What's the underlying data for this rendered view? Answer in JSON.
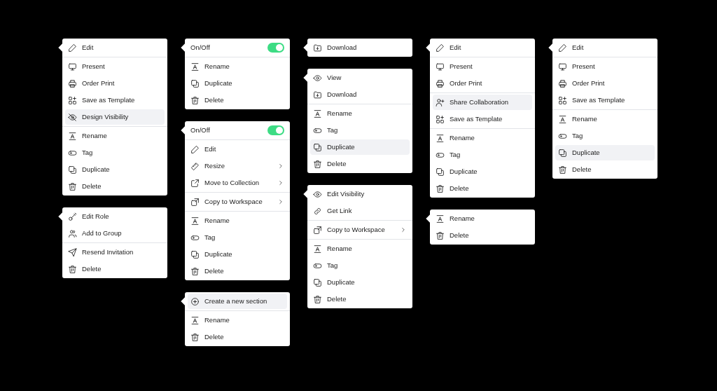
{
  "columns": [
    {
      "menus": [
        {
          "sections": [
            [
              {
                "kind": "edit",
                "label": "Edit",
                "selected": false,
                "submenu": false
              }
            ],
            [
              {
                "kind": "present",
                "label": "Present",
                "selected": false,
                "submenu": false
              },
              {
                "kind": "print",
                "label": "Order Print",
                "selected": false,
                "submenu": false
              },
              {
                "kind": "template",
                "label": "Save as Template",
                "selected": false,
                "submenu": false
              },
              {
                "kind": "hide",
                "label": "Design Visibility",
                "selected": true,
                "submenu": false
              }
            ],
            [
              {
                "kind": "rename",
                "label": "Rename",
                "selected": false,
                "submenu": false
              },
              {
                "kind": "tag",
                "label": "Tag",
                "selected": false,
                "submenu": false
              },
              {
                "kind": "duplicate",
                "label": "Duplicate",
                "selected": false,
                "submenu": false
              },
              {
                "kind": "delete",
                "label": "Delete",
                "selected": false,
                "submenu": false
              }
            ]
          ]
        },
        {
          "sections": [
            [
              {
                "kind": "key",
                "label": "Edit Role",
                "selected": false,
                "submenu": false
              },
              {
                "kind": "users",
                "label": "Add to Group",
                "selected": false,
                "submenu": false
              }
            ],
            [
              {
                "kind": "send",
                "label": "Resend Invitation",
                "selected": false,
                "submenu": false
              },
              {
                "kind": "delete",
                "label": "Delete",
                "selected": false,
                "submenu": false
              }
            ]
          ]
        }
      ]
    },
    {
      "menus": [
        {
          "sections": [
            [
              {
                "kind": "toggle",
                "label": "On/Off",
                "on": true,
                "selected": false,
                "submenu": false
              }
            ],
            [
              {
                "kind": "rename",
                "label": "Rename",
                "selected": false,
                "submenu": false
              },
              {
                "kind": "duplicate",
                "label": "Duplicate",
                "selected": false,
                "submenu": false
              },
              {
                "kind": "delete",
                "label": "Delete",
                "selected": false,
                "submenu": false
              }
            ]
          ]
        },
        {
          "sections": [
            [
              {
                "kind": "toggle",
                "label": "On/Off",
                "on": true,
                "selected": false,
                "submenu": false
              }
            ],
            [
              {
                "kind": "edit",
                "label": "Edit",
                "selected": false,
                "submenu": false
              },
              {
                "kind": "resize",
                "label": "Resize",
                "selected": false,
                "submenu": true
              },
              {
                "kind": "move",
                "label": "Move to Collection",
                "selected": false,
                "submenu": true
              }
            ],
            [
              {
                "kind": "copy",
                "label": "Copy to Workspace",
                "selected": false,
                "submenu": true
              }
            ],
            [
              {
                "kind": "rename",
                "label": "Rename",
                "selected": false,
                "submenu": false
              },
              {
                "kind": "tag",
                "label": "Tag",
                "selected": false,
                "submenu": false
              },
              {
                "kind": "duplicate",
                "label": "Duplicate",
                "selected": false,
                "submenu": false
              },
              {
                "kind": "delete",
                "label": "Delete",
                "selected": false,
                "submenu": false
              }
            ]
          ]
        },
        {
          "sections": [
            [
              {
                "kind": "add",
                "label": "Create a new section",
                "selected": true,
                "submenu": false
              }
            ],
            [
              {
                "kind": "rename",
                "label": "Rename",
                "selected": false,
                "submenu": false
              },
              {
                "kind": "delete",
                "label": "Delete",
                "selected": false,
                "submenu": false
              }
            ]
          ]
        }
      ]
    },
    {
      "menus": [
        {
          "sections": [
            [
              {
                "kind": "download",
                "label": "Download",
                "selected": false,
                "submenu": false
              }
            ]
          ]
        },
        {
          "sections": [
            [
              {
                "kind": "view",
                "label": "View",
                "selected": false,
                "submenu": false
              },
              {
                "kind": "download",
                "label": "Download",
                "selected": false,
                "submenu": false
              }
            ],
            [
              {
                "kind": "rename",
                "label": "Rename",
                "selected": false,
                "submenu": false
              },
              {
                "kind": "tag",
                "label": "Tag",
                "selected": false,
                "submenu": false
              },
              {
                "kind": "duplicate",
                "label": "Duplicate",
                "selected": true,
                "submenu": false
              },
              {
                "kind": "delete",
                "label": "Delete",
                "selected": false,
                "submenu": false
              }
            ]
          ]
        },
        {
          "sections": [
            [
              {
                "kind": "view",
                "label": "Edit Visibility",
                "selected": false,
                "submenu": false
              },
              {
                "kind": "link",
                "label": "Get Link",
                "selected": false,
                "submenu": false
              }
            ],
            [
              {
                "kind": "copy",
                "label": "Copy to Workspace",
                "selected": false,
                "submenu": true
              }
            ],
            [
              {
                "kind": "rename",
                "label": "Rename",
                "selected": false,
                "submenu": false
              },
              {
                "kind": "tag",
                "label": "Tag",
                "selected": false,
                "submenu": false
              },
              {
                "kind": "duplicate",
                "label": "Duplicate",
                "selected": false,
                "submenu": false
              },
              {
                "kind": "delete",
                "label": "Delete",
                "selected": false,
                "submenu": false
              }
            ]
          ]
        }
      ]
    },
    {
      "menus": [
        {
          "sections": [
            [
              {
                "kind": "edit",
                "label": "Edit",
                "selected": false,
                "submenu": false
              }
            ],
            [
              {
                "kind": "present",
                "label": "Present",
                "selected": false,
                "submenu": false
              },
              {
                "kind": "print",
                "label": "Order Print",
                "selected": false,
                "submenu": false
              }
            ],
            [
              {
                "kind": "share",
                "label": "Share Collaboration",
                "selected": true,
                "submenu": false
              },
              {
                "kind": "template",
                "label": "Save as Template",
                "selected": false,
                "submenu": false
              }
            ],
            [
              {
                "kind": "rename",
                "label": "Rename",
                "selected": false,
                "submenu": false
              },
              {
                "kind": "tag",
                "label": "Tag",
                "selected": false,
                "submenu": false
              },
              {
                "kind": "duplicate",
                "label": "Duplicate",
                "selected": false,
                "submenu": false
              },
              {
                "kind": "delete",
                "label": "Delete",
                "selected": false,
                "submenu": false
              }
            ]
          ]
        },
        {
          "sections": [
            [
              {
                "kind": "rename",
                "label": "Rename",
                "selected": false,
                "submenu": false
              },
              {
                "kind": "delete",
                "label": "Delete",
                "selected": false,
                "submenu": false
              }
            ]
          ]
        }
      ]
    },
    {
      "menus": [
        {
          "sections": [
            [
              {
                "kind": "edit",
                "label": "Edit",
                "selected": false,
                "submenu": false
              }
            ],
            [
              {
                "kind": "present",
                "label": "Present",
                "selected": false,
                "submenu": false
              },
              {
                "kind": "print",
                "label": "Order Print",
                "selected": false,
                "submenu": false
              },
              {
                "kind": "template",
                "label": "Save as Template",
                "selected": false,
                "submenu": false
              }
            ],
            [
              {
                "kind": "rename",
                "label": "Rename",
                "selected": false,
                "submenu": false
              },
              {
                "kind": "tag",
                "label": "Tag",
                "selected": false,
                "submenu": false
              },
              {
                "kind": "duplicate",
                "label": "Duplicate",
                "selected": true,
                "submenu": false
              },
              {
                "kind": "delete",
                "label": "Delete",
                "selected": false,
                "submenu": false
              }
            ]
          ]
        }
      ]
    }
  ]
}
